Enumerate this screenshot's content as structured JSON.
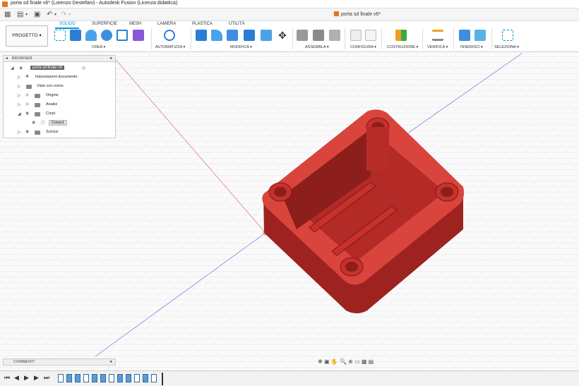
{
  "window": {
    "title": "porta sd finale v6* (Lorenzo Destefani) - Autodesk Fusion (Licenza didattica)"
  },
  "document_tab": {
    "title": "porta sd finale v6*"
  },
  "ribbon": {
    "workspace_button": "PROGETTO ▾",
    "tabs": [
      "SOLIDO",
      "SUPERFICIE",
      "MESH",
      "LAMIERA",
      "PLASTICA",
      "UTILITÀ"
    ],
    "active_tab": "SOLIDO",
    "groups": [
      "CREA ▾",
      "AUTOMATIZZA ▾",
      "MODIFICA ▾",
      "ASSEMBLA ▾",
      "CONFIGURA ▾",
      "COSTRUZIONE ▾",
      "VERIFICA ▾",
      "INSERISCI ▾",
      "SELEZIONA ▾"
    ]
  },
  "browser": {
    "header": "BROWSER",
    "root": "porta sd finale v6",
    "items": [
      "Impostazioni documento",
      "Viste con nome",
      "Origine",
      "Analisi",
      "Corpi",
      "Corpo1",
      "Schizzi"
    ]
  },
  "comments": {
    "header": "COMMENTI"
  },
  "colors": {
    "accent": "#0696d7",
    "body": "#c8302c",
    "body_dark": "#9e2320",
    "body_light": "#d9443c",
    "grid": "#dcdcdc",
    "x_axis": "#e07070",
    "y_axis": "#7070e0"
  }
}
